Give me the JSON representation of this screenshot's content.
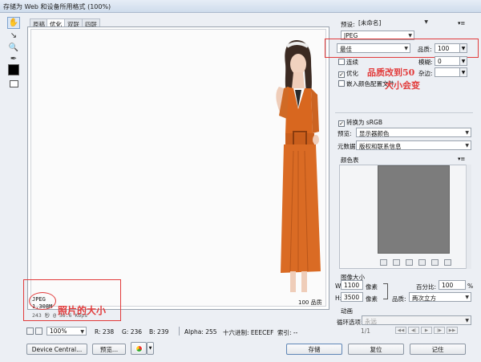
{
  "window": {
    "title": "存储为 Web 和设备所用格式 (100%)"
  },
  "tabs": [
    "原稿",
    "优化",
    "双联",
    "四联"
  ],
  "preview": {
    "info_format": "JPEG",
    "info_size": "1.308M",
    "info_time": "243 秒 @ 56.6 Kbps",
    "info_quality": "100 品质"
  },
  "annotations": {
    "photo_size": "照片的大小",
    "quality_note_1": "品质改到50",
    "quality_note_2": "大小会变"
  },
  "statusbar": {
    "zoom": "100%",
    "r": "R: 238",
    "g": "G: 236",
    "b": "B: 239",
    "alpha": "Alpha: 255",
    "hex": "十六进制: EEECEF",
    "index": "索引: --"
  },
  "bottom_buttons": {
    "device_central": "Device Central...",
    "preview": "预览...",
    "save": "存储",
    "reset": "复位",
    "remember": "记住"
  },
  "settings": {
    "preset_label": "预设:",
    "preset_value": "[未命名]",
    "format": "JPEG",
    "quality_preset": "最佳",
    "quality_label": "品质:",
    "quality_value": "100",
    "progressive": "连续",
    "blur_label": "模糊:",
    "blur_value": "0",
    "optimized": "优化",
    "matte_label": "杂边:",
    "embed_profile": "嵌入颜色配置文件",
    "convert_srgb": "转换为 sRGB",
    "preview_label": "预览:",
    "preview_value": "显示器颜色",
    "metadata_label": "元数据:",
    "metadata_value": "版权和联系信息",
    "color_table": "颜色表",
    "image_size": "图像大小",
    "width_label": "W:",
    "width_value": "1100",
    "height_label": "H:",
    "height_value": "3500",
    "pixel_unit": "像素",
    "percent_label": "百分比:",
    "percent_value": "100",
    "percent_unit": "%",
    "quality_resample_label": "品质:",
    "quality_resample_value": "两次立方",
    "animation": "动画",
    "loop_label": "循环选项:",
    "loop_value": "永远",
    "frame_counter": "1/1"
  }
}
